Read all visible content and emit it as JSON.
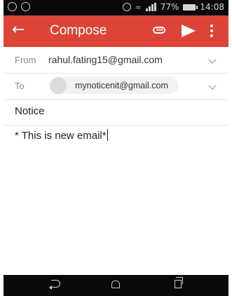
{
  "status_bar": {
    "battery": "77%",
    "time": "14:08"
  },
  "toolbar": {
    "title": "Compose",
    "color": "#db4437"
  },
  "fields": {
    "from_label": "From",
    "from_value": "rahul.fating15@gmail.com",
    "to_label": "To",
    "to_recipient": "mynoticenit@gmail.com",
    "subject": "Notice"
  },
  "body": {
    "text": "* This is new email*"
  },
  "icons": {
    "back": "arrow-back-icon",
    "attach": "paperclip-icon",
    "send": "send-icon",
    "more": "more-vert-icon",
    "nav_back": "nav-back-icon",
    "nav_home": "nav-home-icon",
    "nav_recent": "nav-recents-icon"
  }
}
